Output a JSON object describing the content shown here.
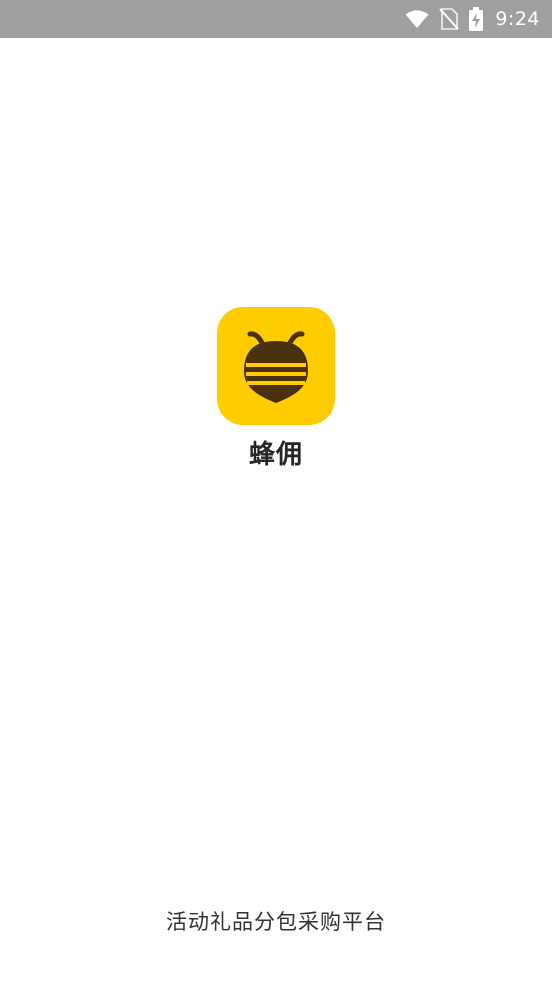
{
  "status_bar": {
    "time": "9:24",
    "icons": [
      "wifi-icon",
      "no-sim-icon",
      "battery-charging-icon"
    ],
    "background": "#a0a0a0"
  },
  "splash": {
    "logo_icon": "bee-icon",
    "logo_background": "#ffcc00",
    "app_name": "蜂佣",
    "slogan": "活动礼品分包采购平台"
  }
}
